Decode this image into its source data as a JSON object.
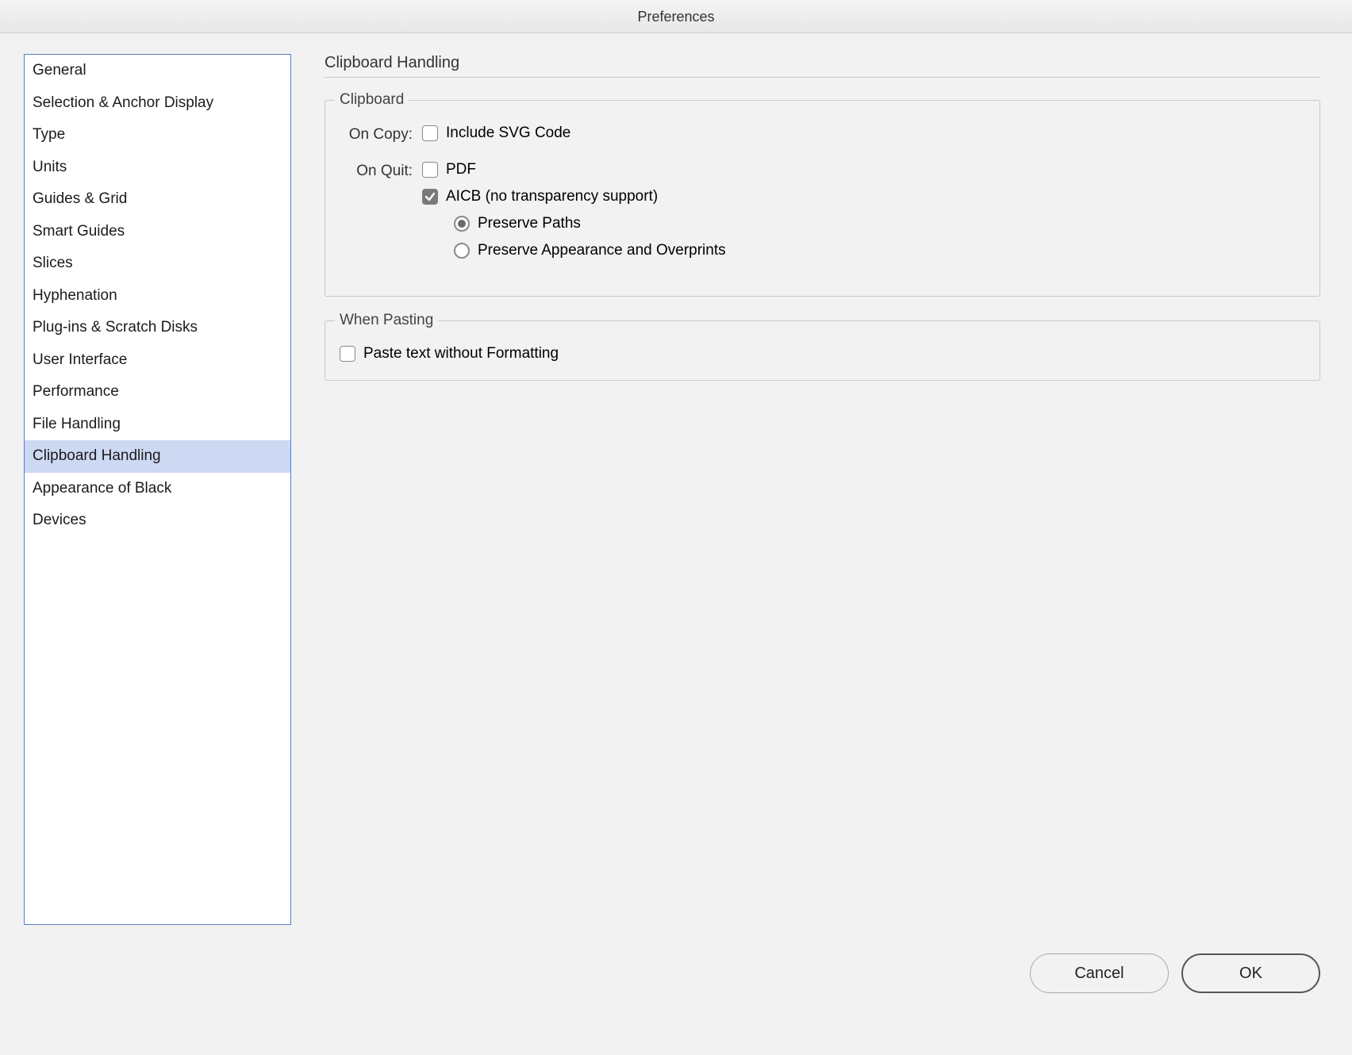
{
  "window": {
    "title": "Preferences"
  },
  "sidebar": {
    "items": [
      {
        "label": "General"
      },
      {
        "label": "Selection & Anchor Display"
      },
      {
        "label": "Type"
      },
      {
        "label": "Units"
      },
      {
        "label": "Guides & Grid"
      },
      {
        "label": "Smart Guides"
      },
      {
        "label": "Slices"
      },
      {
        "label": "Hyphenation"
      },
      {
        "label": "Plug-ins & Scratch Disks"
      },
      {
        "label": "User Interface"
      },
      {
        "label": "Performance"
      },
      {
        "label": "File Handling"
      },
      {
        "label": "Clipboard Handling"
      },
      {
        "label": "Appearance of Black"
      },
      {
        "label": "Devices"
      }
    ],
    "selected_index": 12
  },
  "pane": {
    "title": "Clipboard Handling",
    "clipboard": {
      "legend": "Clipboard",
      "on_copy_label": "On Copy:",
      "include_svg_label": "Include SVG Code",
      "include_svg_checked": false,
      "on_quit_label": "On Quit:",
      "pdf_label": "PDF",
      "pdf_checked": false,
      "aicb_label": "AICB (no transparency support)",
      "aicb_checked": true,
      "radio": {
        "preserve_paths_label": "Preserve Paths",
        "preserve_appearance_label": "Preserve Appearance and Overprints",
        "selected": "paths"
      }
    },
    "pasting": {
      "legend": "When Pasting",
      "paste_without_formatting_label": "Paste text without Formatting",
      "paste_without_formatting_checked": false
    }
  },
  "buttons": {
    "cancel": "Cancel",
    "ok": "OK"
  }
}
